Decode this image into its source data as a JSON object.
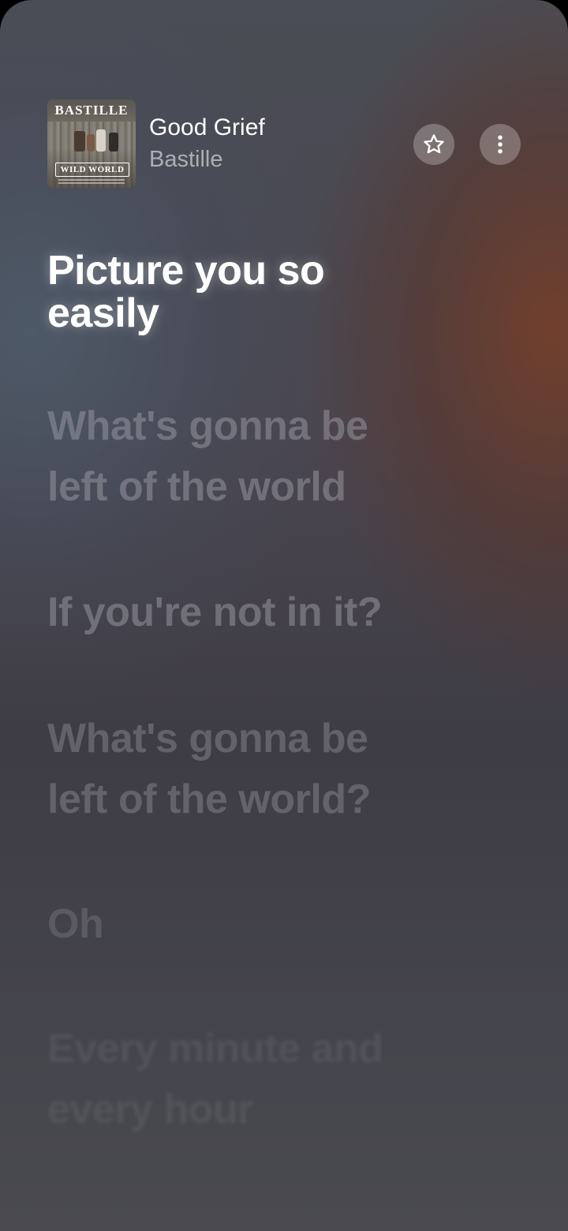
{
  "now_playing": {
    "title": "Good Grief",
    "artist": "Bastille",
    "album_art": {
      "band_text": "BASTILLE",
      "album_text": "WILD WORLD"
    }
  },
  "actions": {
    "favorite_icon": "star-outline-icon",
    "more_icon": "vertical-ellipsis-icon"
  },
  "lyrics": {
    "active": "Picture you so\neasily",
    "upcoming": [
      "What's gonna be\nleft of the world",
      "If you're not in it?",
      "What's gonna be\nleft of the world?",
      "Oh",
      "Every minute and\nevery hour"
    ]
  },
  "colors": {
    "active_lyric": "#ffffff",
    "inactive_lyric": "#96969e",
    "button_bg": "rgba(255,255,255,0.26)",
    "accent_warm": "#783e26",
    "accent_cool": "#4e5c6c"
  }
}
